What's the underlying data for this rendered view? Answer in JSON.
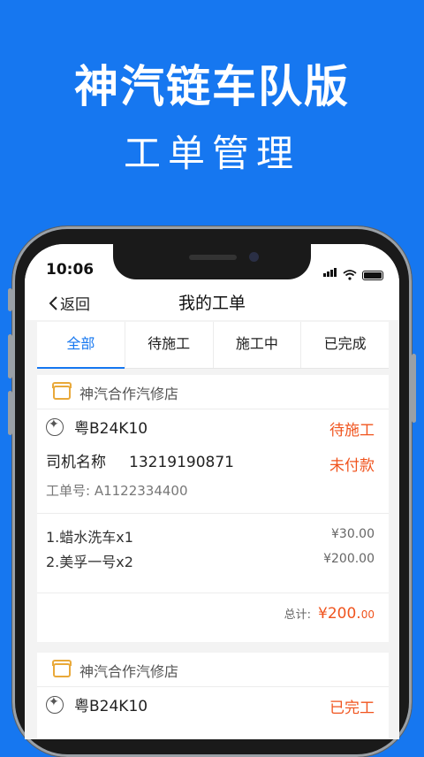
{
  "banner": {
    "title": "神汽链车队版",
    "subtitle": "工单管理"
  },
  "status_bar": {
    "time": "10:06"
  },
  "navbar": {
    "back_label": "返回",
    "title": "我的工单"
  },
  "tabs": [
    "全部",
    "待施工",
    "施工中",
    "已完成"
  ],
  "active_tab": "全部",
  "orders": [
    {
      "shop": "神汽合作汽修店",
      "plate": "粤B24K10",
      "status": "待施工",
      "driver": "司机名称",
      "phone": "13219190871",
      "payment": "未付款",
      "order_no": "工单号: A1122334400",
      "items": [
        {
          "name": "1.蜡水洗车x1",
          "price": "¥30.00"
        },
        {
          "name": "2.美孚一号x2",
          "price": "¥200.00"
        }
      ],
      "total_label": "总计:",
      "total_main": "¥200.",
      "total_cents": "00"
    },
    {
      "shop": "神汽合作汽修店",
      "plate": "粤B24K10",
      "status": "已完工"
    }
  ],
  "colors": {
    "brand_blue": "#1677f0",
    "accent_red": "#f0541e",
    "shop_icon": "#e9a93a"
  }
}
